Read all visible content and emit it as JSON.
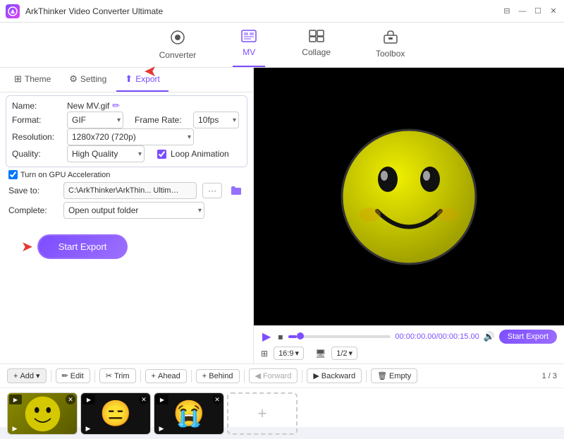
{
  "app": {
    "title": "ArkThinker Video Converter Ultimate",
    "logo_text": "A"
  },
  "titlebar": {
    "controls": [
      "⊟",
      "—",
      "☐",
      "✕"
    ]
  },
  "topnav": {
    "items": [
      {
        "id": "converter",
        "label": "Converter",
        "icon": "⚙",
        "active": false
      },
      {
        "id": "mv",
        "label": "MV",
        "icon": "🖼",
        "active": true
      },
      {
        "id": "collage",
        "label": "Collage",
        "icon": "⊞",
        "active": false
      },
      {
        "id": "toolbox",
        "label": "Toolbox",
        "icon": "🧰",
        "active": false
      }
    ]
  },
  "tabs": [
    {
      "id": "theme",
      "label": "Theme",
      "icon": "⊞",
      "active": false
    },
    {
      "id": "setting",
      "label": "Setting",
      "icon": "⚙",
      "active": false
    },
    {
      "id": "export",
      "label": "Export",
      "icon": "⬆",
      "active": true
    }
  ],
  "settings": {
    "name_label": "Name:",
    "name_value": "New MV.gif",
    "format_label": "Format:",
    "format_value": "GIF",
    "framerate_label": "Frame Rate:",
    "framerate_value": "10fps",
    "resolution_label": "Resolution:",
    "resolution_value": "1280x720 (720p)",
    "quality_label": "Quality:",
    "quality_value": "High Quality",
    "gpu_label": "Turn on GPU Acceleration",
    "save_label": "Save to:",
    "save_path": "C:\\ArkThinker\\ArkThin... Ultimate\\MV Exported",
    "complete_label": "Complete:",
    "complete_value": "Open output folder",
    "loop_label": "Loop Animation"
  },
  "buttons": {
    "start_export": "Start Export",
    "start_export_right": "Start Export",
    "add": "Add",
    "edit": "Edit",
    "trim": "Trim",
    "ahead": "Ahead",
    "behind": "Behind",
    "forward": "Forward",
    "backward": "Backward",
    "empty": "Empty"
  },
  "player": {
    "time_current": "00:00:00.00",
    "time_total": "00:00:15.00",
    "ratio": "16:9",
    "scale": "1/2"
  },
  "clips": [
    {
      "id": 1,
      "emoji": "😊",
      "bg": "#c8c000",
      "label": "clip-smiley"
    },
    {
      "id": 2,
      "emoji": "😑",
      "bg": "#1a1a1a",
      "label": "clip-sad"
    },
    {
      "id": 3,
      "emoji": "😭",
      "bg": "#1a1a1a",
      "label": "clip-cry"
    }
  ],
  "pagination": {
    "current": 1,
    "total": 3,
    "display": "1 / 3"
  }
}
